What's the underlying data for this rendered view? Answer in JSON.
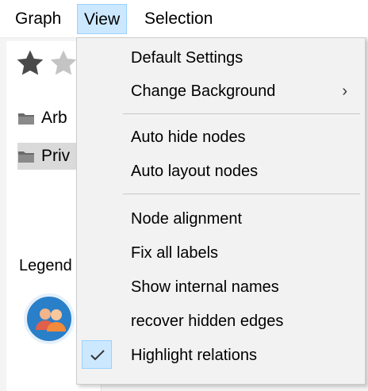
{
  "menubar": {
    "items": [
      {
        "label": "Graph"
      },
      {
        "label": "View",
        "active": true
      },
      {
        "label": "Selection"
      }
    ]
  },
  "background": {
    "rating_icons": [
      "star-filled-icon",
      "star-empty-icon"
    ],
    "tree_items": [
      {
        "label": "Arb",
        "icon": "folder-icon"
      },
      {
        "label": "Priv",
        "icon": "folder-icon",
        "selected": true
      }
    ],
    "legend_label": "Legend",
    "avatar_icon": "users-group-icon"
  },
  "view_menu": {
    "items": [
      {
        "label": "Default Settings"
      },
      {
        "label": "Change Background",
        "submenu": true,
        "submenu_glyph": "›"
      },
      {
        "label": "Auto hide nodes"
      },
      {
        "label": "Auto layout nodes"
      },
      {
        "label": "Node alignment"
      },
      {
        "label": "Fix all labels"
      },
      {
        "label": "Show internal names"
      },
      {
        "label": "recover hidden edges"
      },
      {
        "label": "Highlight relations",
        "checked": true
      }
    ]
  },
  "colors": {
    "highlight_fill": "#cce8ff",
    "highlight_border": "#99d1ff",
    "menu_background": "#f2f2f2",
    "separator": "#c8c8c8",
    "avatar_blue": "#2a7fc9"
  }
}
